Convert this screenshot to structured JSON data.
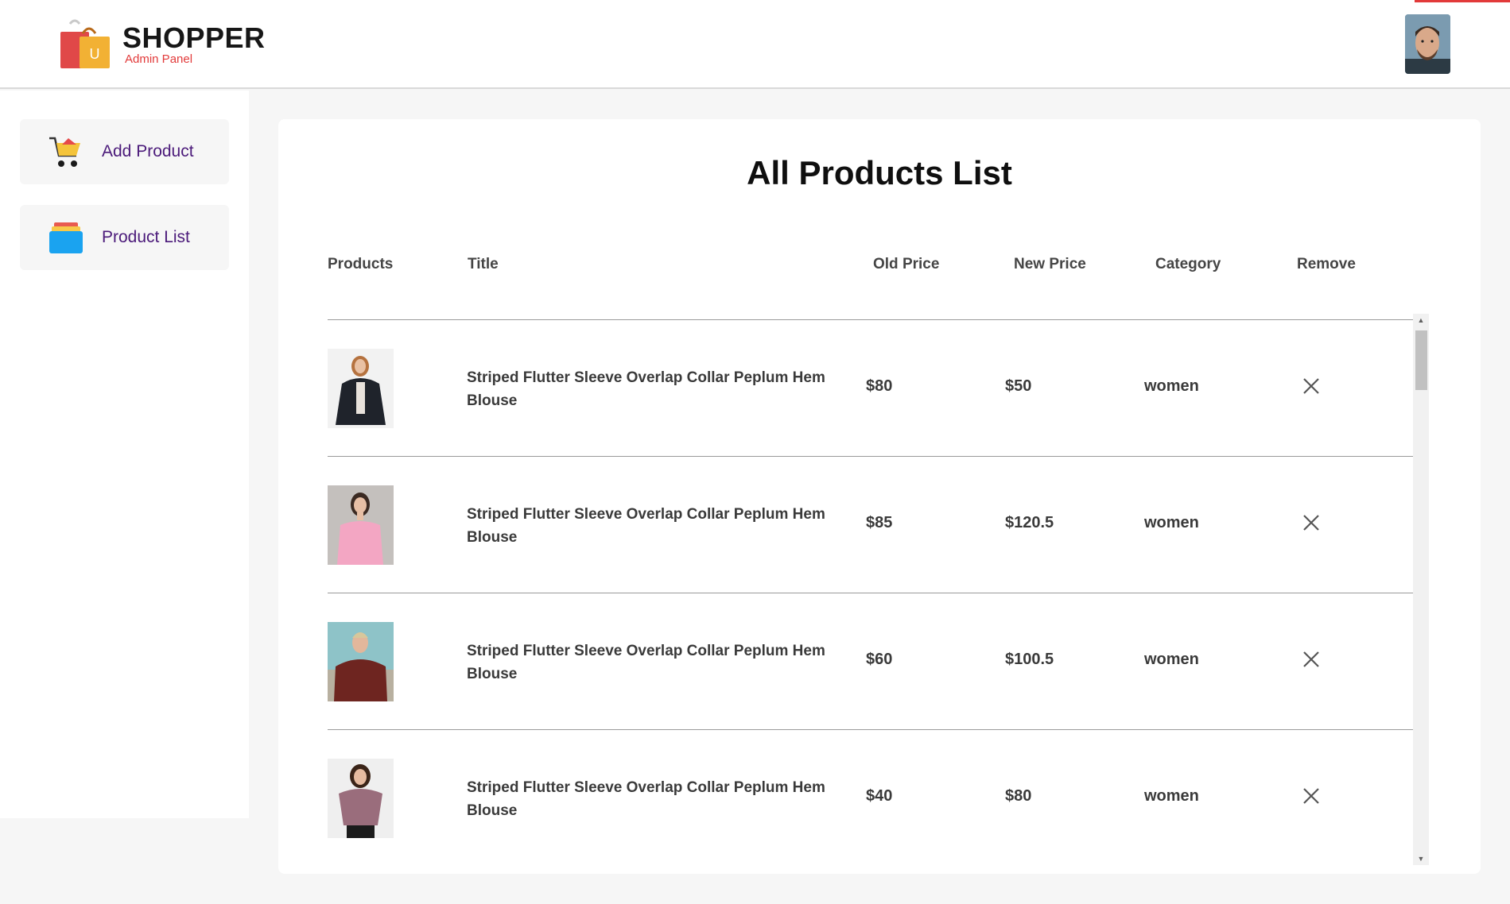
{
  "header": {
    "brand_name": "SHOPPER",
    "brand_sub": "Admin Panel",
    "logo_letter": "U",
    "accent_color": "#e23a3a"
  },
  "sidebar": {
    "items": [
      {
        "label": "Add Product",
        "icon": "cart-icon"
      },
      {
        "label": "Product List",
        "icon": "product-list-icon"
      }
    ]
  },
  "main": {
    "title": "All Products List",
    "columns": [
      "Products",
      "Title",
      "Old Price",
      "New Price",
      "Category",
      "Remove"
    ],
    "rows": [
      {
        "title": "Striped Flutter Sleeve Overlap Collar Peplum Hem Blouse",
        "old_price": "$80",
        "new_price": "$50",
        "category": "women"
      },
      {
        "title": "Striped Flutter Sleeve Overlap Collar Peplum Hem Blouse",
        "old_price": "$85",
        "new_price": "$120.5",
        "category": "women"
      },
      {
        "title": "Striped Flutter Sleeve Overlap Collar Peplum Hem Blouse",
        "old_price": "$60",
        "new_price": "$100.5",
        "category": "women"
      },
      {
        "title": "Striped Flutter Sleeve Overlap Collar Peplum Hem Blouse",
        "old_price": "$40",
        "new_price": "$80",
        "category": "women"
      }
    ]
  }
}
